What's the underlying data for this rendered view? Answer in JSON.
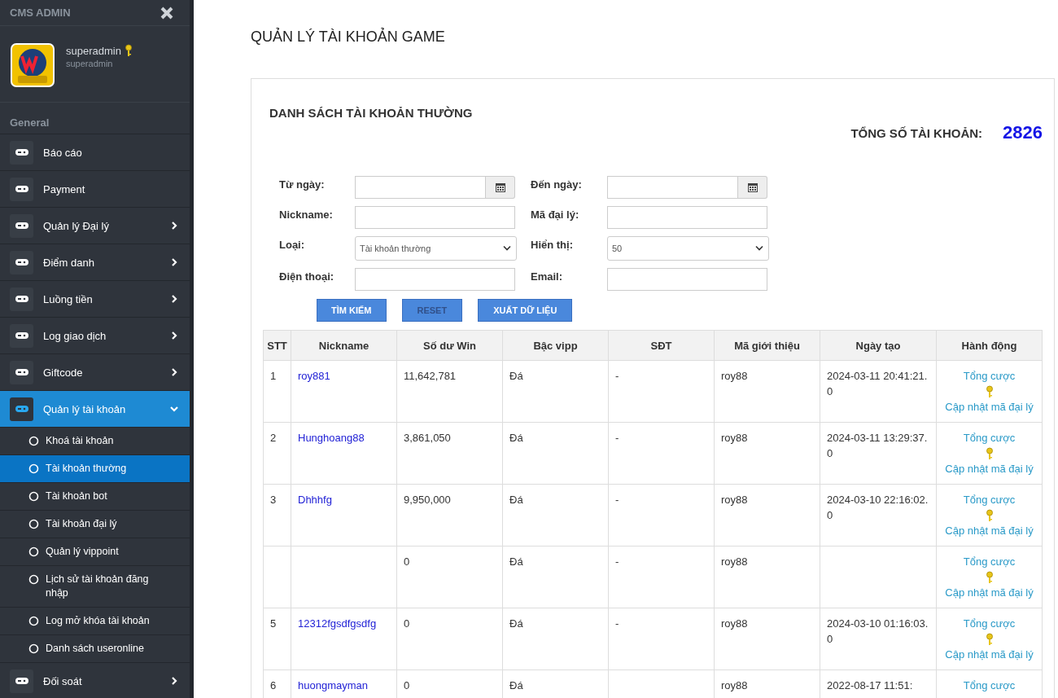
{
  "sidebar": {
    "brand": "CMS ADMIN",
    "user": {
      "name": "superadmin",
      "role": "superadmin"
    },
    "section_label": "General",
    "items": [
      {
        "label": "Báo cáo",
        "has_submenu": false,
        "selected": false
      },
      {
        "label": "Payment",
        "has_submenu": false,
        "selected": false
      },
      {
        "label": "Quản lý Đại lý",
        "has_submenu": true,
        "expanded": false,
        "selected": false
      },
      {
        "label": "Điểm danh",
        "has_submenu": true,
        "expanded": false,
        "selected": false
      },
      {
        "label": "Luồng tiền",
        "has_submenu": true,
        "expanded": false,
        "selected": false
      },
      {
        "label": "Log giao dịch",
        "has_submenu": true,
        "expanded": false,
        "selected": false
      },
      {
        "label": "Giftcode",
        "has_submenu": true,
        "expanded": false,
        "selected": false
      },
      {
        "label": "Quản lý tài khoản",
        "has_submenu": true,
        "expanded": true,
        "selected": true,
        "children": [
          {
            "label": "Khoá tài khoản",
            "selected": false
          },
          {
            "label": "Tài khoản thường",
            "selected": true
          },
          {
            "label": "Tài khoản bot",
            "selected": false
          },
          {
            "label": "Tài khoản đại lý",
            "selected": false
          },
          {
            "label": "Quản lý vippoint",
            "selected": false
          },
          {
            "label": "Lịch sử tài khoản đăng nhập",
            "selected": false
          },
          {
            "label": "Log mở khóa tài khoản",
            "selected": false
          },
          {
            "label": "Danh sách useronline",
            "selected": false
          }
        ]
      },
      {
        "label": "Đối soát",
        "has_submenu": true,
        "expanded": false,
        "selected": false
      }
    ]
  },
  "page_title": "QUẢN LÝ TÀI KHOẢN GAME",
  "panel": {
    "title": "DANH SÁCH TÀI KHOẢN THƯỜNG",
    "total_label": "TỔNG SỐ TÀI KHOẢN:",
    "total_value": "2826",
    "filters": [
      {
        "kind": "date",
        "label": "Từ ngày:"
      },
      {
        "kind": "date",
        "label": "Đến ngày:"
      },
      {
        "kind": "text",
        "label": "Nickname:"
      },
      {
        "kind": "text",
        "label": "Mã đại lý:"
      },
      {
        "kind": "select",
        "label": "Loại:",
        "value": "Tài khoản thường"
      },
      {
        "kind": "select",
        "label": "Hiển thị:",
        "value": "50"
      },
      {
        "kind": "text",
        "label": "Điện thoại:"
      },
      {
        "kind": "text",
        "label": "Email:"
      }
    ],
    "buttons": [
      "TÌM KIẾM",
      "RESET",
      "XUẤT DỮ LIỆU"
    ],
    "table": {
      "columns": [
        "STT",
        "Nickname",
        "Số dư Win",
        "Bậc vipp",
        "SĐT",
        "Mã giới thiệu",
        "Ngày tạo",
        "Hành động"
      ],
      "rows": [
        {
          "stt": "1",
          "nickname": "roy881",
          "balance": "11,642,781",
          "vip": "Đá",
          "phone": "-",
          "referral": "roy88",
          "created": "2024-03-11 20:41:21.0",
          "actions": [
            "Tổng cược",
            "Cập nhật mã đại lý"
          ]
        },
        {
          "stt": "2",
          "nickname": "Hunghoang88",
          "balance": "3,861,050",
          "vip": "Đá",
          "phone": "-",
          "referral": "roy88",
          "created": "2024-03-11 13:29:37.0",
          "actions": [
            "Tổng cược",
            "Cập nhật mã đại lý"
          ]
        },
        {
          "stt": "3",
          "nickname": "Dhhhfg",
          "balance": "9,950,000",
          "vip": "Đá",
          "phone": "-",
          "referral": "roy88",
          "created": "2024-03-10 22:16:02.0",
          "actions": [
            "Tổng cược",
            "Cập nhật mã đại lý"
          ]
        },
        {
          "balance": "0",
          "vip": "Đá",
          "phone": "-",
          "referral": "roy88",
          "actions": [
            "Tổng cược",
            "Cập nhật mã đại lý"
          ]
        },
        {
          "stt": "5",
          "nickname": "12312fgsdfgsdfg",
          "balance": "0",
          "vip": "Đá",
          "phone": "-",
          "referral": "roy88",
          "created": "2024-03-10 01:16:03.0",
          "actions": [
            "Tổng cược",
            "Cập nhật mã đại lý"
          ]
        },
        {
          "stt": "6",
          "nickname": "huongmayman",
          "balance": "0",
          "vip": "Đá",
          "referral": "roy88",
          "created": "2022-08-17 11:51:",
          "actions": [
            "Tổng cược"
          ]
        }
      ]
    }
  }
}
